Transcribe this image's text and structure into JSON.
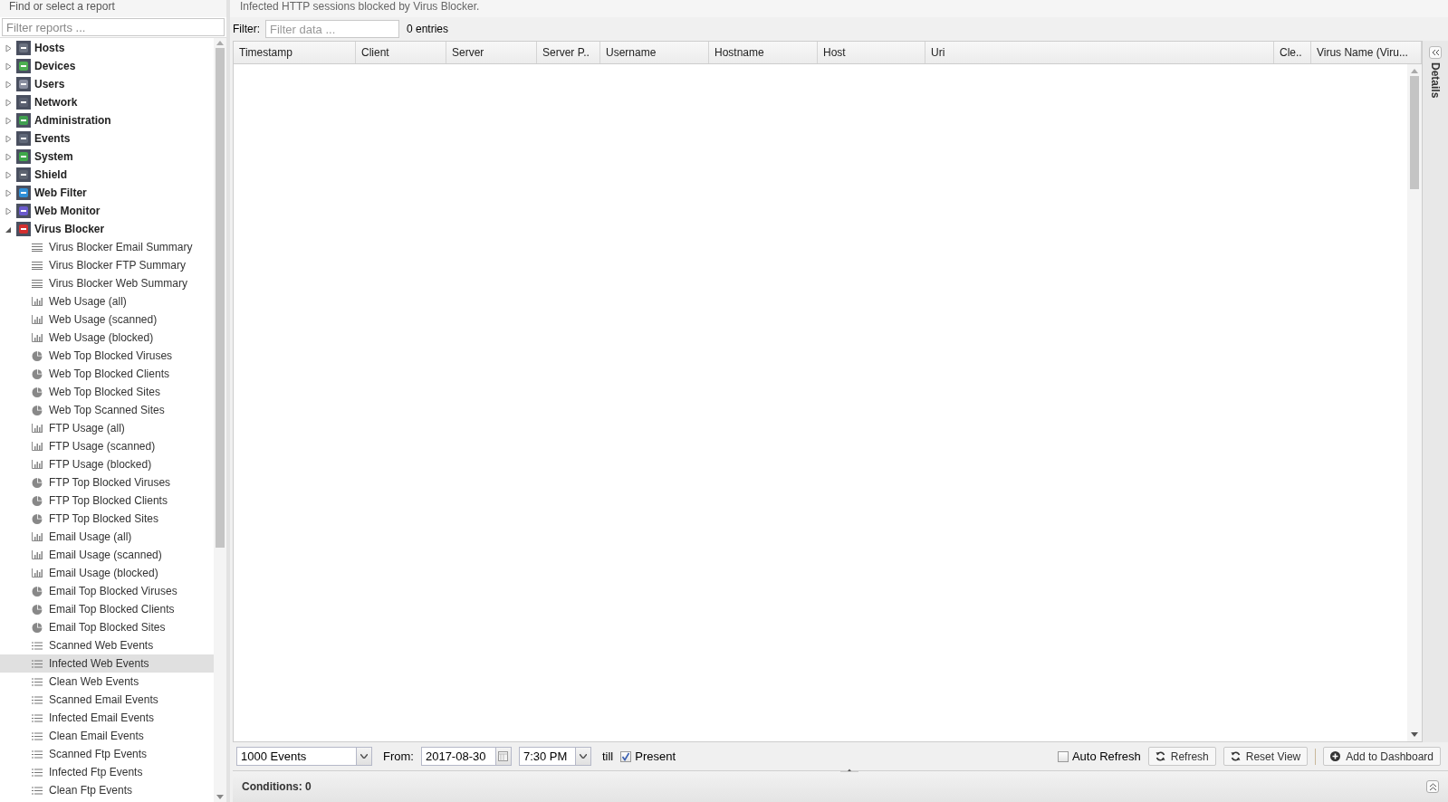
{
  "sidebar": {
    "title": "Find or select a report",
    "search": {
      "placeholder": "Filter reports ..."
    },
    "tree": [
      {
        "label": "Hosts",
        "expanded": false
      },
      {
        "label": "Devices",
        "expanded": false
      },
      {
        "label": "Users",
        "expanded": false
      },
      {
        "label": "Network",
        "expanded": false
      },
      {
        "label": "Administration",
        "expanded": false
      },
      {
        "label": "Events",
        "expanded": false
      },
      {
        "label": "System",
        "expanded": false
      },
      {
        "label": "Shield",
        "expanded": false
      },
      {
        "label": "Web Filter",
        "expanded": false
      },
      {
        "label": "Web Monitor",
        "expanded": false
      },
      {
        "label": "Virus Blocker",
        "expanded": true,
        "children": [
          {
            "label": "Virus Blocker Email Summary",
            "kind": "text",
            "selected": false
          },
          {
            "label": "Virus Blocker FTP Summary",
            "kind": "text",
            "selected": false
          },
          {
            "label": "Virus Blocker Web Summary",
            "kind": "text",
            "selected": false
          },
          {
            "label": "Web Usage (all)",
            "kind": "bar",
            "selected": false
          },
          {
            "label": "Web Usage (scanned)",
            "kind": "bar",
            "selected": false
          },
          {
            "label": "Web Usage (blocked)",
            "kind": "bar",
            "selected": false
          },
          {
            "label": "Web Top Blocked Viruses",
            "kind": "pie",
            "selected": false
          },
          {
            "label": "Web Top Blocked Clients",
            "kind": "pie",
            "selected": false
          },
          {
            "label": "Web Top Blocked Sites",
            "kind": "pie",
            "selected": false
          },
          {
            "label": "Web Top Scanned Sites",
            "kind": "pie",
            "selected": false
          },
          {
            "label": "FTP Usage (all)",
            "kind": "bar",
            "selected": false
          },
          {
            "label": "FTP Usage (scanned)",
            "kind": "bar",
            "selected": false
          },
          {
            "label": "FTP Usage (blocked)",
            "kind": "bar",
            "selected": false
          },
          {
            "label": "FTP Top Blocked Viruses",
            "kind": "pie",
            "selected": false
          },
          {
            "label": "FTP Top Blocked Clients",
            "kind": "pie",
            "selected": false
          },
          {
            "label": "FTP Top Blocked Sites",
            "kind": "pie",
            "selected": false
          },
          {
            "label": "Email Usage (all)",
            "kind": "bar",
            "selected": false
          },
          {
            "label": "Email Usage (scanned)",
            "kind": "bar",
            "selected": false
          },
          {
            "label": "Email Usage (blocked)",
            "kind": "bar",
            "selected": false
          },
          {
            "label": "Email Top Blocked Viruses",
            "kind": "pie",
            "selected": false
          },
          {
            "label": "Email Top Blocked Clients",
            "kind": "pie",
            "selected": false
          },
          {
            "label": "Email Top Blocked Sites",
            "kind": "pie",
            "selected": false
          },
          {
            "label": "Scanned Web Events",
            "kind": "events",
            "selected": false
          },
          {
            "label": "Infected Web Events",
            "kind": "events",
            "selected": true
          },
          {
            "label": "Clean Web Events",
            "kind": "events",
            "selected": false
          },
          {
            "label": "Scanned Email Events",
            "kind": "events",
            "selected": false
          },
          {
            "label": "Infected Email Events",
            "kind": "events",
            "selected": false
          },
          {
            "label": "Clean Email Events",
            "kind": "events",
            "selected": false
          },
          {
            "label": "Scanned Ftp Events",
            "kind": "events",
            "selected": false
          },
          {
            "label": "Infected Ftp Events",
            "kind": "events",
            "selected": false
          },
          {
            "label": "Clean Ftp Events",
            "kind": "events",
            "selected": false
          }
        ]
      }
    ]
  },
  "report": {
    "description": "Infected HTTP sessions blocked by Virus Blocker.",
    "filter": {
      "label": "Filter:",
      "placeholder": "Filter data ...",
      "count": "0 entries"
    },
    "table": {
      "columns": [
        "Timestamp",
        "Client",
        "Server",
        "Server P..",
        "Username",
        "Hostname",
        "Host",
        "Uri",
        "Cle..",
        "Virus Name (Viru..."
      ]
    },
    "toolbar": {
      "limit": "1000 Events",
      "from_label": "From:",
      "date": "2017-08-30",
      "time": "7:30 PM",
      "till_label": "till",
      "present": {
        "label": "Present",
        "checked": true
      },
      "auto_refresh": {
        "label": "Auto Refresh",
        "checked": false
      },
      "buttons": [
        "Refresh",
        "Reset View",
        "Add to Dashboard"
      ]
    },
    "conditions": "Conditions: 0"
  },
  "details_panel": {
    "label": "Details"
  }
}
